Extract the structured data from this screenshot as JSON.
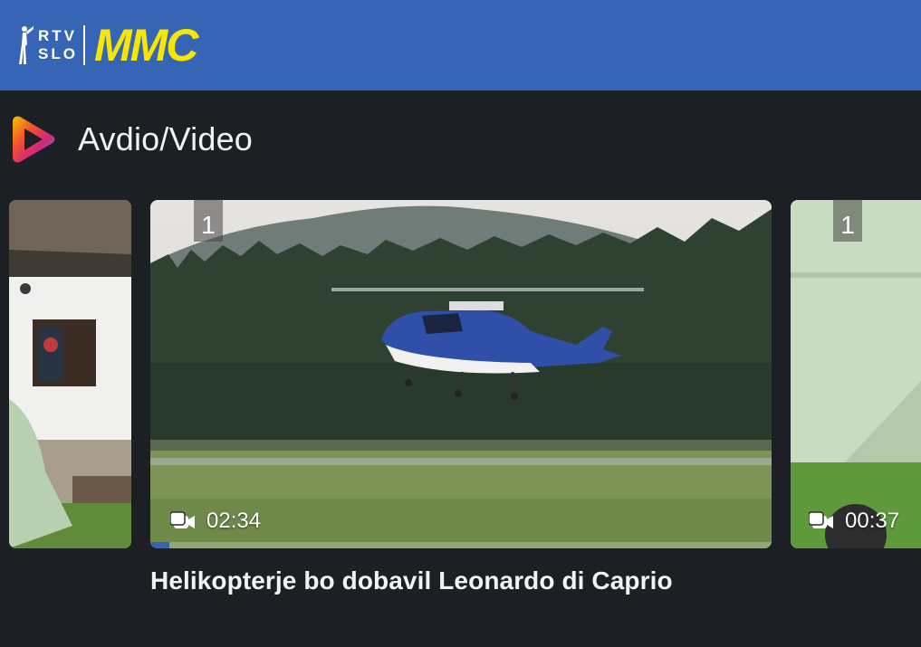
{
  "header": {
    "logo_rtv_line1": "RTV",
    "logo_rtv_line2": "SLO",
    "logo_mmc": "MMC",
    "brand_color": "#3565b4",
    "mmc_color": "#f6e600"
  },
  "section": {
    "title": "Avdio/Video",
    "icon": "play-icon"
  },
  "carousel": {
    "items": [
      {
        "badge": "",
        "duration": "",
        "thumb": "house-thumbnail"
      },
      {
        "badge": "1",
        "duration": "02:34",
        "thumb": "helicopter-thumbnail",
        "progress": 0.03,
        "title": "Helikopterje bo dobavil Leonardo di Caprio"
      },
      {
        "badge": "1",
        "duration": "00:37",
        "thumb": "building-thumbnail"
      }
    ]
  }
}
